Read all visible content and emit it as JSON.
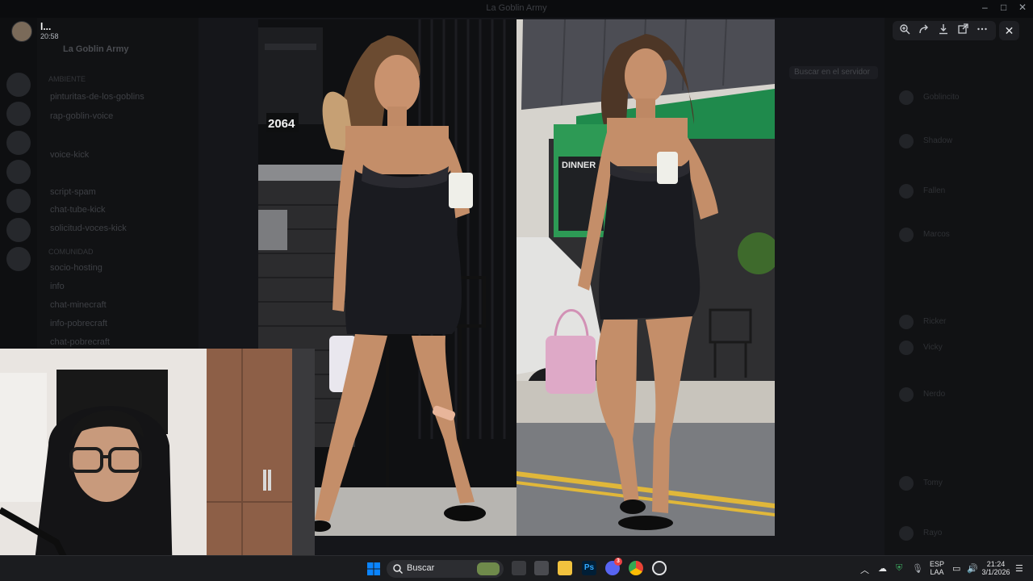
{
  "window": {
    "title": "La Goblin Army"
  },
  "server": {
    "name": "La Goblin Army"
  },
  "channels": [
    "pinturitas-de-los-goblins",
    "rap-goblin-voice",
    "voice-kick",
    "script-spam",
    "chat-tube-kick",
    "solicitud-voces-kick",
    "socio-hosting",
    "info",
    "chat-minecraft",
    "info-pobrecraft",
    "chat-pobrecraft"
  ],
  "channel_categories": [
    "ambiente",
    "comunidad"
  ],
  "main": {
    "search_placeholder": "Buscar en el servidor"
  },
  "members": [
    "Goblincito",
    "Shadow",
    "Fallen",
    "Marcos",
    "Ricker",
    "Vicky",
    "Nerdo",
    "Tomy",
    "Rayo"
  ],
  "viewer": {
    "author": "l...",
    "timestamp": "20:58",
    "house_number": "2064",
    "sign_text": "DINNER",
    "tools": [
      "zoom-in-icon",
      "forward-icon",
      "download-icon",
      "open-external-icon",
      "more-icon"
    ],
    "close_icon": "close-icon"
  },
  "taskbar": {
    "search_label": "Buscar",
    "language_top": "ESP",
    "language_bottom": "LAA",
    "time": "21:24",
    "date": "3/1/2026",
    "apps": [
      "file-explorer-icon",
      "task-view-icon",
      "files-icon",
      "photoshop-icon",
      "discord-icon",
      "chrome-icon",
      "obs-icon"
    ],
    "ps_label": "Ps",
    "discord_badge": "3"
  },
  "colors": {
    "accent": "#5865f2",
    "windows_blue": "#0a84ff",
    "dress": "#1a1b20",
    "skin": "#c48e69",
    "sign_green": "#1f8a4c"
  }
}
